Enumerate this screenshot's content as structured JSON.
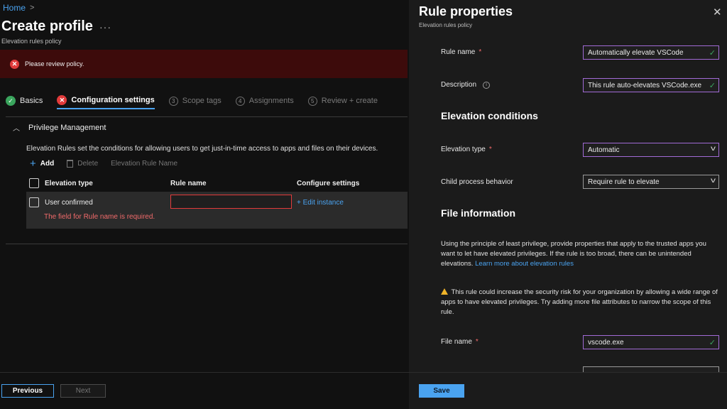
{
  "breadcrumb": {
    "home": "Home",
    "separator": ">"
  },
  "page": {
    "title": "Create profile",
    "more": "···",
    "subtitle": "Elevation rules policy"
  },
  "banner": {
    "message": "Please review policy."
  },
  "tabs": [
    {
      "label": "Basics",
      "state": "done",
      "marker": "✓"
    },
    {
      "label": "Configuration settings",
      "state": "error",
      "marker": "✕"
    },
    {
      "label": "Scope tags",
      "state": "disabled",
      "marker": "3"
    },
    {
      "label": "Assignments",
      "state": "disabled",
      "marker": "4"
    },
    {
      "label": "Review + create",
      "state": "disabled",
      "marker": "5"
    }
  ],
  "section": {
    "title": "Privilege Management",
    "description": "Elevation Rules set the conditions for allowing users to get just-in-time access to apps and files on their devices."
  },
  "toolbar": {
    "add": "Add",
    "delete": "Delete",
    "elevation_rule_name": "Elevation Rule Name"
  },
  "table": {
    "headers": [
      "Elevation type",
      "Rule name",
      "Configure settings"
    ],
    "row": {
      "elevation_type": "User confirmed",
      "rule_name": "",
      "configure": "+ Edit instance",
      "error": "The field for Rule name is required."
    }
  },
  "footer": {
    "previous": "Previous",
    "next": "Next"
  },
  "panel": {
    "title": "Rule properties",
    "subtitle": "Elevation rules policy",
    "rule_name": {
      "label": "Rule name",
      "value": "Automatically elevate VSCode"
    },
    "description": {
      "label": "Description",
      "value": "This rule auto-elevates VSCode.exe"
    },
    "elevation_conditions": "Elevation conditions",
    "elevation_type": {
      "label": "Elevation type",
      "value": "Automatic"
    },
    "child_process": {
      "label": "Child process behavior",
      "value": "Require rule to elevate"
    },
    "file_information": "File information",
    "info_text": "Using the principle of least privilege, provide properties that apply to the trusted apps you want to let have elevated privileges. If the rule is too broad, there can be unintended elevations.",
    "info_link": "Learn more about elevation rules",
    "warning_text": "This rule could increase the security risk for your organization by allowing a wide range of apps to have elevated privileges. Try adding more file attributes to narrow the scope of this rule.",
    "file_name": {
      "label": "File name",
      "value": "vscode.exe"
    },
    "save": "Save"
  },
  "colors": {
    "accent": "#4aa3f0",
    "error": "#e23b3b",
    "success": "#3aa55d",
    "valid_border": "#a26bd6",
    "warning": "#f0b429"
  }
}
